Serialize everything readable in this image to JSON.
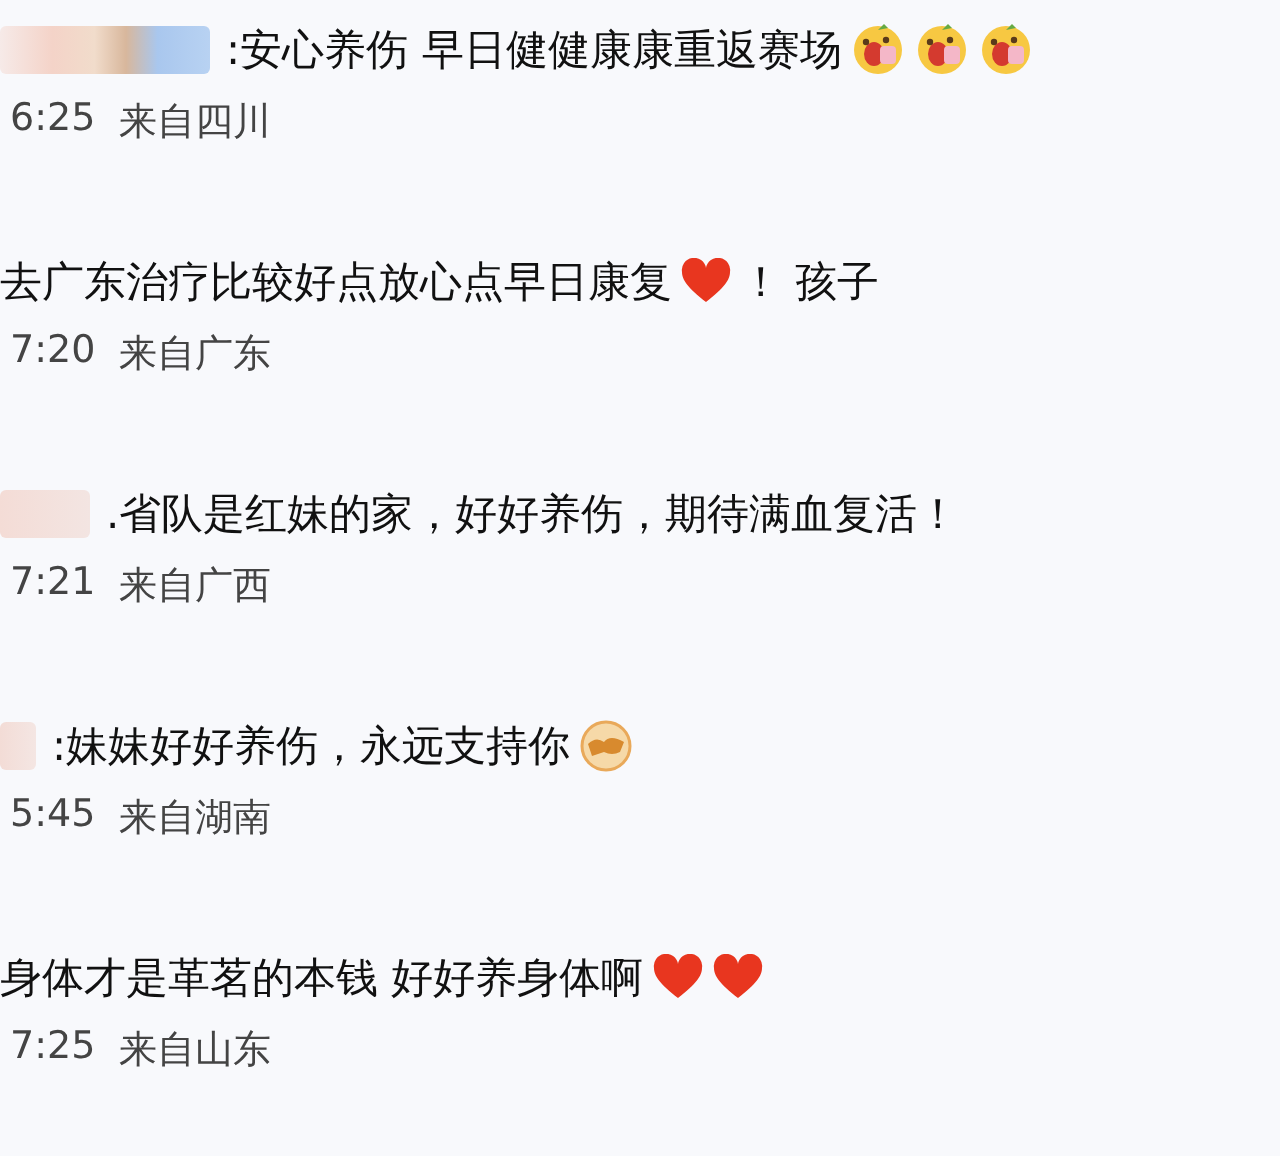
{
  "comments": [
    {
      "kind": "blurlong",
      "text": ":安心养伤 早日健健康康重返赛场",
      "emojis": [
        {
          "kind": "laugh"
        },
        {
          "kind": "laugh"
        },
        {
          "kind": "laugh"
        }
      ],
      "time": "6:25",
      "location": "来自四川"
    },
    {
      "kind": "plain",
      "text": "去广东治疗比较好点放心点早日康复",
      "emojis": [
        {
          "kind": "heart"
        }
      ],
      "tail": "！ 孩子",
      "time": "7:20",
      "location": "来自广东"
    },
    {
      "kind": "blurshort",
      "text": ".省队是红妹的家，好好养伤，期待满血复活！",
      "time": "7:21",
      "location": "来自广西"
    },
    {
      "kind": "blurtiny",
      "text": ":妹妹好好养伤，永远支持你",
      "emojis": [
        {
          "kind": "fist"
        }
      ],
      "time": "5:45",
      "location": "来自湖南"
    },
    {
      "kind": "plain",
      "text": "身体才是革茗的本钱 好好养身体啊",
      "emojis": [
        {
          "kind": "heart"
        },
        {
          "kind": "heart"
        }
      ],
      "time": "7:25",
      "location": "来自山东"
    }
  ]
}
